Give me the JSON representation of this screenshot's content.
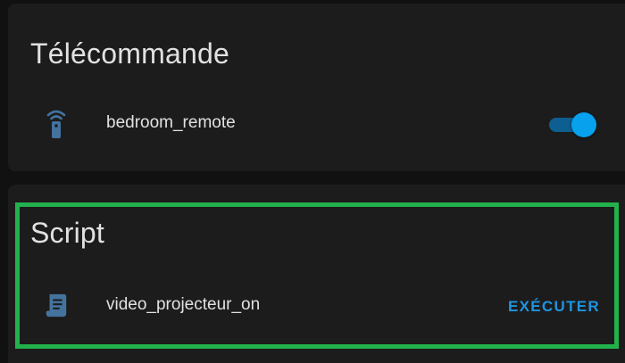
{
  "remote_card": {
    "title": "Télécommande",
    "entity": {
      "icon": "remote-icon",
      "label": "bedroom_remote",
      "toggle_on": true
    }
  },
  "script_card": {
    "title": "Script",
    "entity": {
      "icon": "script-icon",
      "label": "video_projecteur_on",
      "action_label": "EXÉCUTER"
    }
  },
  "colors": {
    "background": "#111111",
    "card": "#1c1c1c",
    "accent": "#08a1ee",
    "icon": "#44739e",
    "highlight": "#22b14c"
  }
}
